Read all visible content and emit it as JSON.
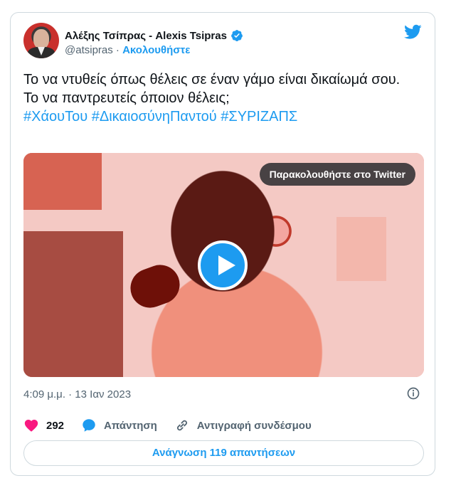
{
  "tweet": {
    "author_name": "Αλέξης Τσίπρας - Alexis Tsipras",
    "handle": "@atsipras",
    "separator": " · ",
    "follow_label": "Ακολουθήστε",
    "text_line1": "Το να ντυθείς όπως θέλεις σε έναν γάμο είναι δικαίωμά σου.",
    "text_line2": "Το να παντρευτείς όποιον θέλεις;",
    "hashtags": [
      "#ΧάουΤου",
      "#ΔικαιοσύνηΠαντού",
      "#ΣΥΡΙΖΑΠΣ"
    ],
    "timestamp": "4:09 μ.μ. · 13 Ιαν 2023"
  },
  "media": {
    "watch_label": "Παρακολουθήστε στο Twitter"
  },
  "actions": {
    "like_count": "292",
    "reply_label": "Απάντηση",
    "copy_link_label": "Αντιγραφή συνδέσμου",
    "read_replies_label": "Ανάγνωση 119 απαντήσεων"
  },
  "colors": {
    "brand_blue": "#1d9bf0",
    "like_pink": "#f91880",
    "muted": "#536471"
  },
  "icons": [
    "verified-badge-icon",
    "twitter-bird-icon",
    "play-icon",
    "info-icon",
    "heart-icon",
    "reply-bubble-icon",
    "link-icon"
  ]
}
